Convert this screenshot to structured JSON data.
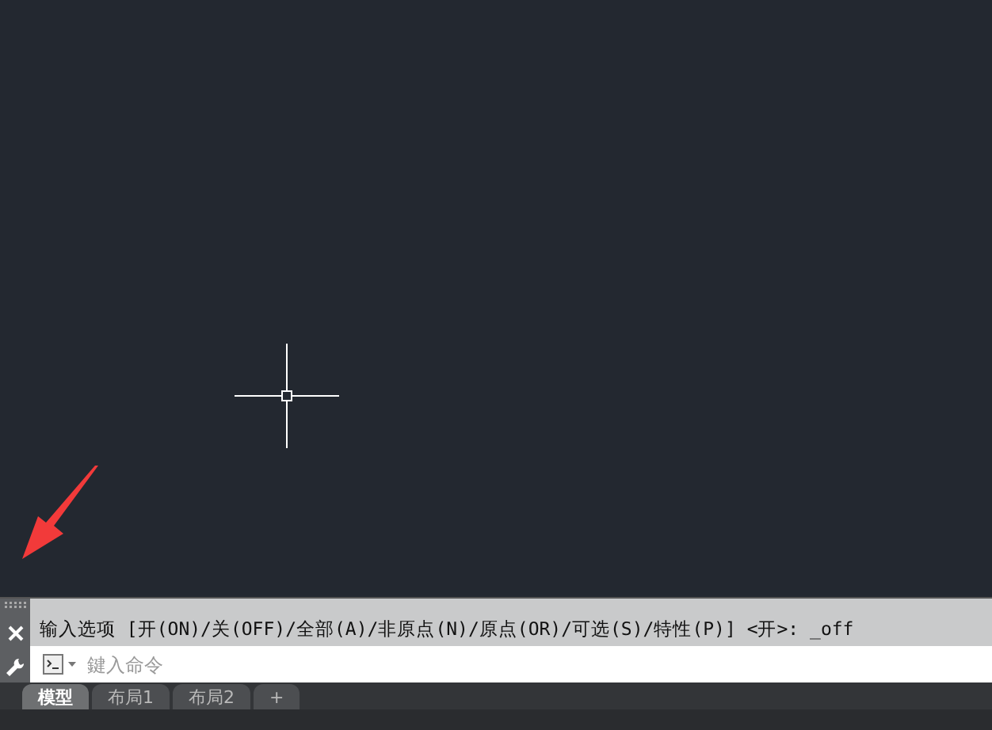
{
  "command_history": "输入选项 [开(ON)/关(OFF)/全部(A)/非原点(N)/原点(OR)/可选(S)/特性(P)] <开>: _off",
  "command_input": {
    "placeholder": "鍵入命令"
  },
  "layout_tabs": [
    {
      "label": "模型",
      "selected": true
    },
    {
      "label": "布局1",
      "selected": false
    },
    {
      "label": "布局2",
      "selected": false
    }
  ],
  "add_tab": "+"
}
